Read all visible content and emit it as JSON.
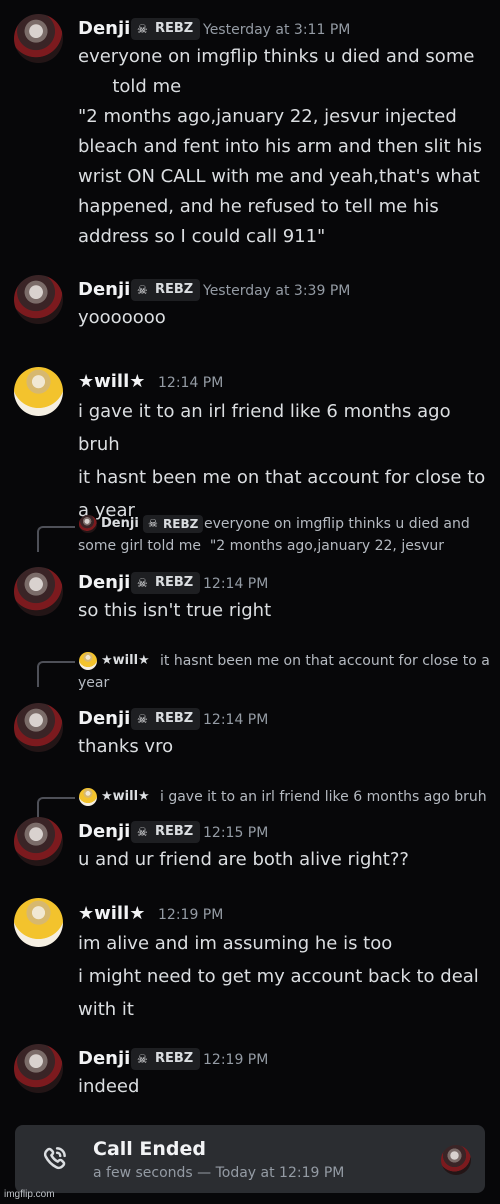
{
  "messages": [
    {
      "author": "Denji",
      "tag": "REBZ",
      "time": "Yesterday at 3:11 PM",
      "text": "everyone on imgflip thinks u died and some\n      told me\n\"2 months ago,january 22, jesvur injected\nbleach and fent into his arm and then slit his\nwrist ON CALL with me and yeah,that's what\nhappened, and he refused to tell me his\naddress so I could call 911\""
    },
    {
      "author": "Denji",
      "tag": "REBZ",
      "time": "Yesterday at 3:39 PM",
      "text": "yooooooo"
    },
    {
      "author": "★will★",
      "time": "12:14 PM",
      "text": "i gave it to an irl friend like 6 months ago bruh\nit hasnt been me on that account for close to\na year"
    },
    {
      "reply": {
        "author": "Denji",
        "tag": "REBZ",
        "text": "everyone on imgflip thinks u died and\nsome girl told me  \"2 months ago,january 22, jesvur"
      },
      "author": "Denji",
      "tag": "REBZ",
      "time": "12:14 PM",
      "text": "so this isn't true right"
    },
    {
      "reply": {
        "author": "★will★",
        "text": "it hasnt been me on that account for close to a\nyear"
      },
      "author": "Denji",
      "tag": "REBZ",
      "time": "12:14 PM",
      "text": "thanks vro"
    },
    {
      "reply": {
        "author": "★will★",
        "text": "i gave it to an irl friend like 6 months ago bruh"
      },
      "author": "Denji",
      "tag": "REBZ",
      "time": "12:15 PM",
      "text": "u and ur friend are both alive right??"
    },
    {
      "author": "★will★",
      "time": "12:19 PM",
      "text": "im alive and im assuming he is too\ni might need to get my account back to deal\nwith it"
    },
    {
      "author": "Denji",
      "tag": "REBZ",
      "time": "12:19 PM",
      "text": "indeed"
    }
  ],
  "call": {
    "title": "Call Ended",
    "subtitle": "a few seconds — Today at 12:19 PM"
  },
  "watermark": "imgflip.com",
  "icons": {
    "tag_icon": "skull-icon",
    "call_icon": "phone-icon"
  },
  "colors": {
    "background": "#070709",
    "username": "#f2f3f5",
    "timestamp": "#949ba4",
    "message_text": "#dbdee1",
    "tag_bg": "#1e1f22",
    "call_card_bg": "#2b2d31"
  }
}
